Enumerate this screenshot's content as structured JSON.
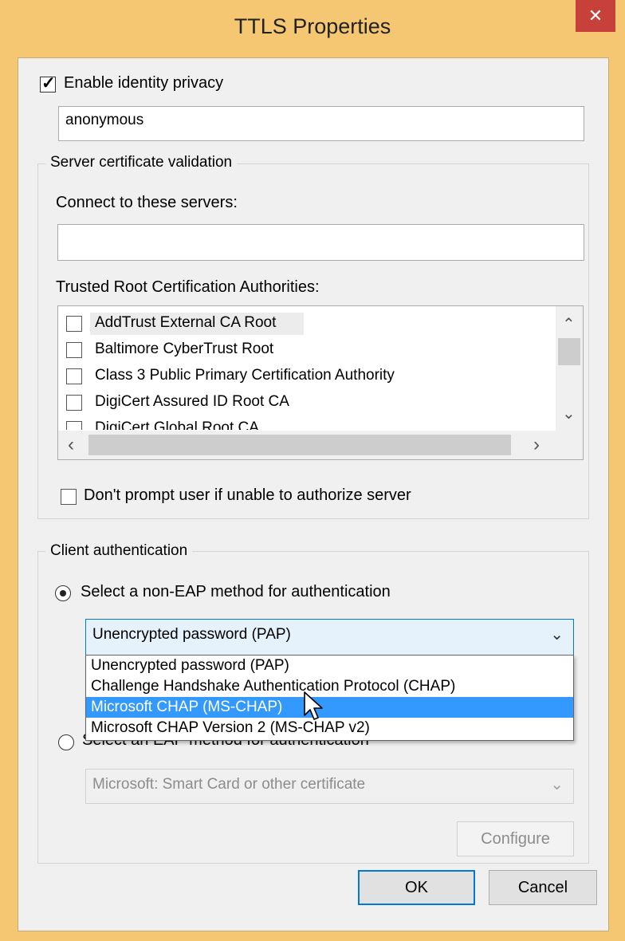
{
  "window": {
    "title": "TTLS Properties",
    "close_glyph": "✕",
    "accent_color": "#f5c773",
    "close_color": "#c7413a"
  },
  "identity_privacy": {
    "label": "Enable identity privacy",
    "checked": true,
    "value": "anonymous"
  },
  "server_validation": {
    "group_label": "Server certificate validation",
    "connect_label": "Connect to these servers:",
    "connect_value": "",
    "trusted_label": "Trusted Root Certification Authorities:",
    "authorities": [
      {
        "label": "AddTrust External CA Root",
        "checked": false
      },
      {
        "label": "Baltimore CyberTrust Root",
        "checked": false
      },
      {
        "label": "Class 3 Public Primary Certification Authority",
        "checked": false
      },
      {
        "label": "DigiCert Assured ID Root CA",
        "checked": false
      },
      {
        "label": "DigiCert Global Root CA",
        "checked": false
      }
    ],
    "dont_prompt_label": "Don't prompt user if unable to authorize server",
    "dont_prompt_checked": false
  },
  "client_auth": {
    "group_label": "Client authentication",
    "non_eap_label": "Select a non-EAP method for authentication",
    "non_eap_selected": true,
    "non_eap_value": "Unencrypted password (PAP)",
    "non_eap_options": [
      "Unencrypted password (PAP)",
      "Challenge Handshake Authentication Protocol (CHAP)",
      "Microsoft CHAP (MS-CHAP)",
      "Microsoft CHAP Version 2 (MS-CHAP v2)"
    ],
    "highlighted_option": "Microsoft CHAP (MS-CHAP)",
    "eap_label": "Select an EAP method for authentication",
    "eap_value": "Microsoft: Smart Card or other certificate",
    "configure_label": "Configure"
  },
  "buttons": {
    "ok_label": "OK",
    "cancel_label": "Cancel"
  },
  "icons": {
    "scroll_up": "⌃",
    "scroll_down": "⌄",
    "scroll_left": "‹",
    "scroll_right": "›",
    "combo_arrow": "⌄"
  }
}
